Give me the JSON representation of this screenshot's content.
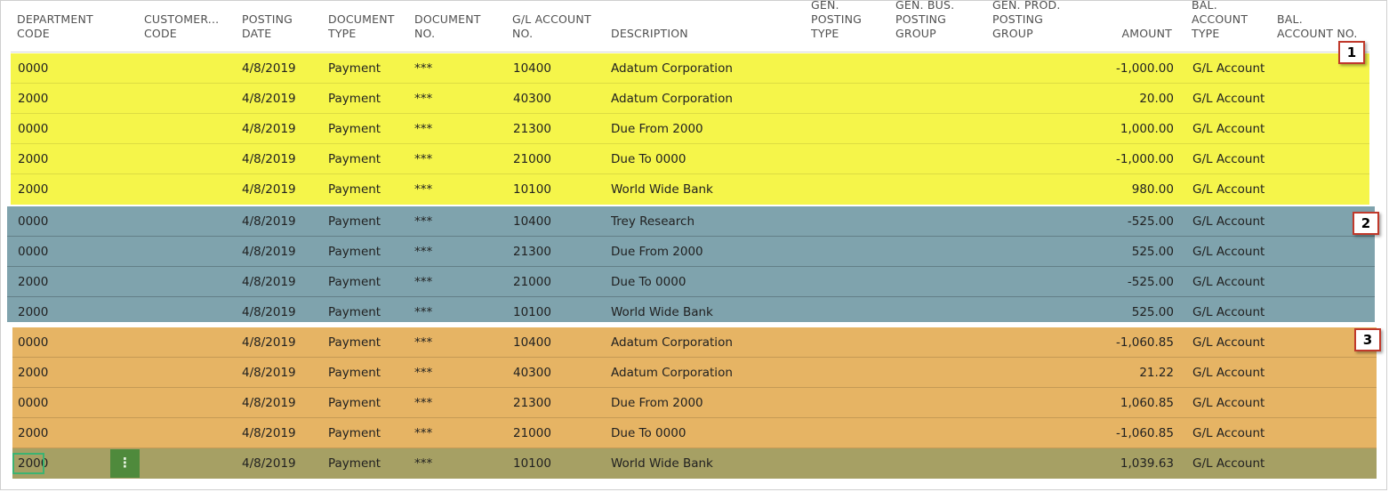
{
  "columns": {
    "department_code": "DEPARTMENT\nCODE",
    "customer_code": "CUSTOMER...\nCODE",
    "posting_date": "POSTING\nDATE",
    "document_type": "DOCUMENT\nTYPE",
    "document_no": "DOCUMENT\nNO.",
    "gl_account_no": "G/L ACCOUNT\nNO.",
    "description": "DESCRIPTION",
    "gen_posting_type": "GEN.\nPOSTING\nTYPE",
    "gen_bus_posting_group": "GEN. BUS.\nPOSTING\nGROUP",
    "gen_prod_posting_group": "GEN. PROD.\nPOSTING\nGROUP",
    "amount": "AMOUNT",
    "bal_account_type": "BAL.\nACCOUNT\nTYPE",
    "bal_account_no": "BAL.\nACCOUNT NO."
  },
  "groups": [
    {
      "badge": "1",
      "color": "#f5f54a",
      "rows": [
        {
          "dept": "0000",
          "customer": "",
          "date": "4/8/2019",
          "doc_type": "Payment",
          "doc_no": "***",
          "gl": "10400",
          "desc": "Adatum Corporation",
          "amount": "-1,000.00",
          "bal_type": "G/L Account"
        },
        {
          "dept": "2000",
          "customer": "",
          "date": "4/8/2019",
          "doc_type": "Payment",
          "doc_no": "***",
          "gl": "40300",
          "desc": "Adatum Corporation",
          "amount": "20.00",
          "bal_type": "G/L Account"
        },
        {
          "dept": "0000",
          "customer": "",
          "date": "4/8/2019",
          "doc_type": "Payment",
          "doc_no": "***",
          "gl": "21300",
          "desc": "Due From 2000",
          "amount": "1,000.00",
          "bal_type": "G/L Account"
        },
        {
          "dept": "2000",
          "customer": "",
          "date": "4/8/2019",
          "doc_type": "Payment",
          "doc_no": "***",
          "gl": "21000",
          "desc": "Due To 0000",
          "amount": "-1,000.00",
          "bal_type": "G/L Account"
        },
        {
          "dept": "2000",
          "customer": "",
          "date": "4/8/2019",
          "doc_type": "Payment",
          "doc_no": "***",
          "gl": "10100",
          "desc": "World Wide Bank",
          "amount": "980.00",
          "bal_type": "G/L Account"
        }
      ]
    },
    {
      "badge": "2",
      "color": "#7fa3ad",
      "rows": [
        {
          "dept": "0000",
          "customer": "",
          "date": "4/8/2019",
          "doc_type": "Payment",
          "doc_no": "***",
          "gl": "10400",
          "desc": "Trey Research",
          "amount": "-525.00",
          "bal_type": "G/L Account"
        },
        {
          "dept": "0000",
          "customer": "",
          "date": "4/8/2019",
          "doc_type": "Payment",
          "doc_no": "***",
          "gl": "21300",
          "desc": "Due From 2000",
          "amount": "525.00",
          "bal_type": "G/L Account"
        },
        {
          "dept": "2000",
          "customer": "",
          "date": "4/8/2019",
          "doc_type": "Payment",
          "doc_no": "***",
          "gl": "21000",
          "desc": "Due To 0000",
          "amount": "-525.00",
          "bal_type": "G/L Account"
        },
        {
          "dept": "2000",
          "customer": "",
          "date": "4/8/2019",
          "doc_type": "Payment",
          "doc_no": "***",
          "gl": "10100",
          "desc": "World Wide Bank",
          "amount": "525.00",
          "bal_type": "G/L Account"
        }
      ]
    },
    {
      "badge": "3",
      "color": "#e6b464",
      "rows": [
        {
          "dept": "0000",
          "customer": "",
          "date": "4/8/2019",
          "doc_type": "Payment",
          "doc_no": "***",
          "gl": "10400",
          "desc": "Adatum Corporation",
          "amount": "-1,060.85",
          "bal_type": "G/L Account"
        },
        {
          "dept": "2000",
          "customer": "",
          "date": "4/8/2019",
          "doc_type": "Payment",
          "doc_no": "***",
          "gl": "40300",
          "desc": "Adatum Corporation",
          "amount": "21.22",
          "bal_type": "G/L Account"
        },
        {
          "dept": "0000",
          "customer": "",
          "date": "4/8/2019",
          "doc_type": "Payment",
          "doc_no": "***",
          "gl": "21300",
          "desc": "Due From 2000",
          "amount": "1,060.85",
          "bal_type": "G/L Account"
        },
        {
          "dept": "2000",
          "customer": "",
          "date": "4/8/2019",
          "doc_type": "Payment",
          "doc_no": "***",
          "gl": "21000",
          "desc": "Due To 0000",
          "amount": "-1,060.85",
          "bal_type": "G/L Account"
        },
        {
          "dept": "2000",
          "customer": "",
          "date": "4/8/2019",
          "doc_type": "Payment",
          "doc_no": "***",
          "gl": "10100",
          "desc": "World Wide Bank",
          "amount": "1,039.63",
          "bal_type": "G/L Account",
          "selected": true
        }
      ]
    }
  ],
  "row_actions_icon": "more-options-icon",
  "row_actions_glyph": "⋮",
  "selected_row_color": "#a6a064"
}
